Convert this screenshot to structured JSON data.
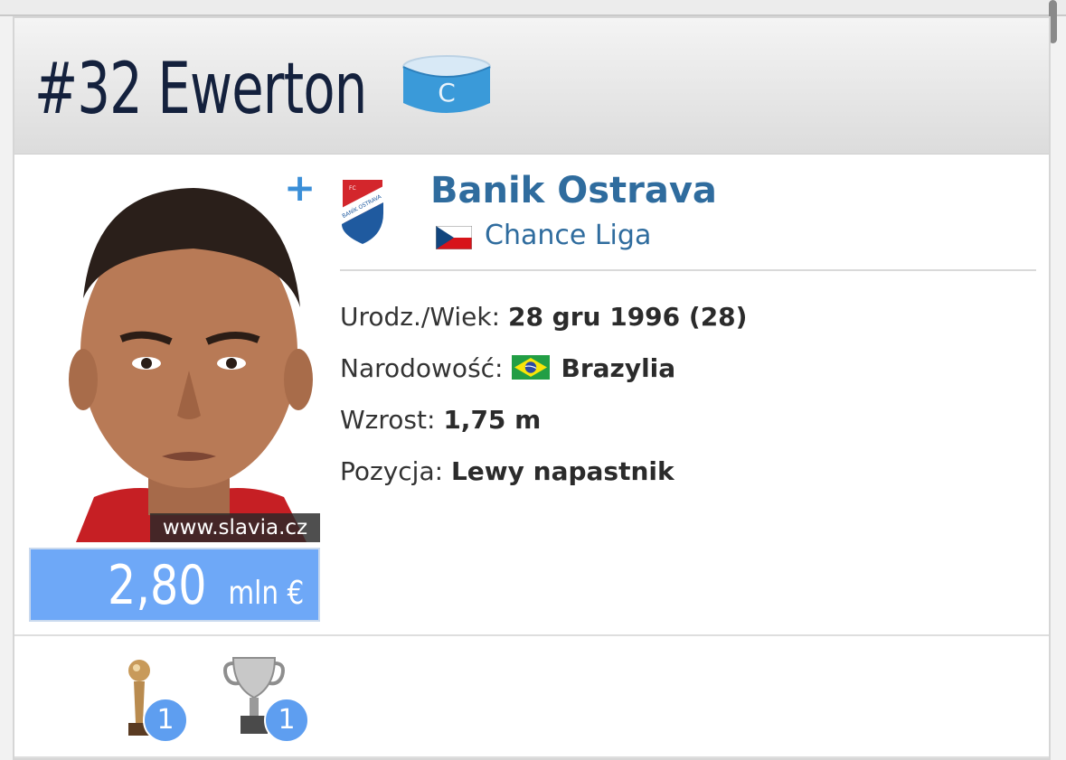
{
  "player": {
    "title": "#32 Ewerton",
    "captain_badge_letter": "C",
    "photo_credit": "www.slavia.cz",
    "add_icon": "+",
    "market_value": {
      "amount": "2,80",
      "unit": "mln €"
    }
  },
  "club": {
    "name": "Banik Ostrava",
    "logo_text": "BANÍK OSTRAVA",
    "logo_prefix": "FC",
    "league": "Chance Liga",
    "league_flag": "czech-flag-icon"
  },
  "info": {
    "birth_label": "Urodz./Wiek:",
    "birth_value": "28 gru 1996 (28)",
    "nationality_label": "Narodowość:",
    "nationality_value": "Brazylia",
    "nationality_flag": "brazil-flag-icon",
    "height_label": "Wzrost:",
    "height_value": "1,75 m",
    "position_label": "Pozycja:",
    "position_value": "Lewy napastnik"
  },
  "achievements": [
    {
      "icon": "award-trophy-icon",
      "count": "1"
    },
    {
      "icon": "cup-trophy-icon",
      "count": "1"
    }
  ],
  "colors": {
    "title_text": "#14213d",
    "link_blue": "#2f6c9e",
    "market_value_bg": "#6ea8f7",
    "badge_blue": "#5e9ef0",
    "captain_blue": "#3a9ad9"
  }
}
